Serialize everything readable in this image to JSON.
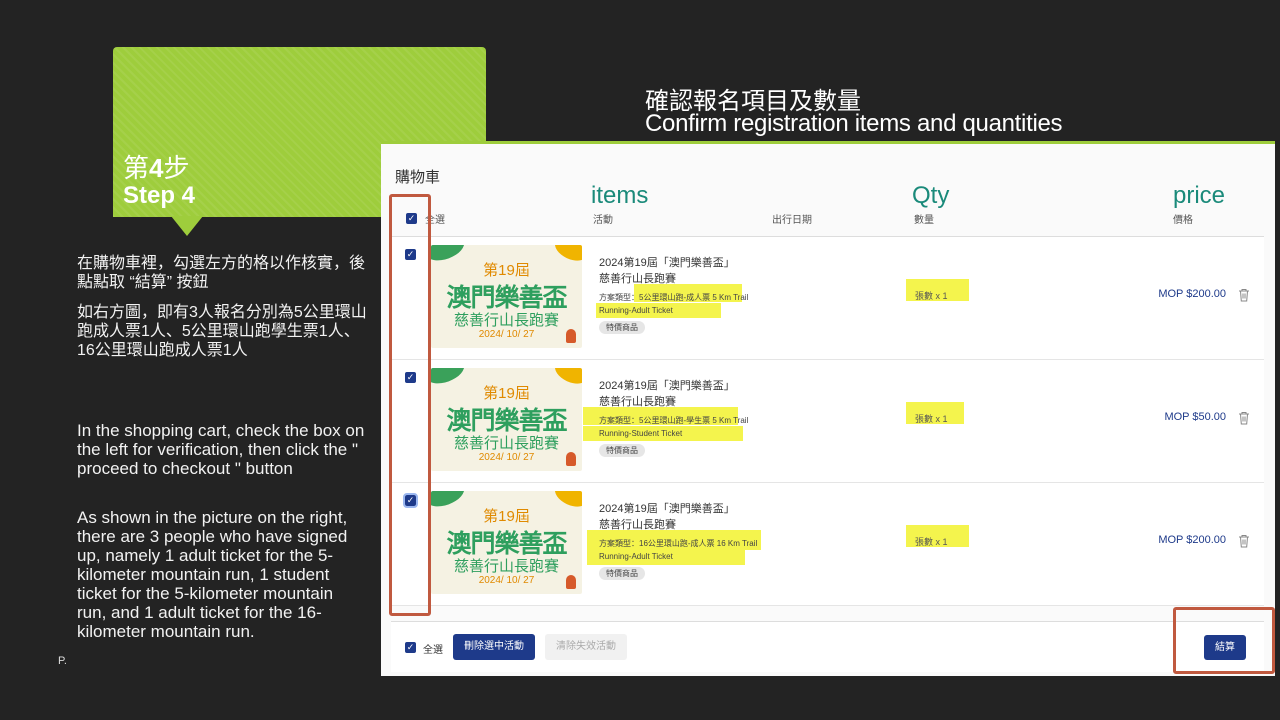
{
  "slide": {
    "step_zh_prefix": "第",
    "step_zh_num": "4",
    "step_zh_suffix": "步",
    "step_en": "Step 4",
    "title_zh": "確認報名項目及數量",
    "title_en": "Confirm registration items and quantities",
    "instruction_zh": "在購物車裡，勾選左方的格以作核實，後點點取 “結算” 按鈕",
    "example_zh": "如右方圖，即有3人報名分別為5公里環山跑成人票1人、5公里環山跑學生票1人、16公里環山跑成人票1人",
    "instruction_en": "In the shopping cart, check the box on the left for verification, then click the \" proceed to checkout \" button",
    "example_en": "As shown in the picture on the right, there are 3 people who have signed up, namely 1 adult ticket for the 5-kilometer mountain run, 1 student ticket for the 5-kilometer mountain run, and 1 adult ticket for the 16-kilometer mountain run.",
    "page_marker": "P."
  },
  "cart": {
    "title": "購物車",
    "annotations": {
      "items": "items",
      "qty": "Qty",
      "price": "price"
    },
    "columns": {
      "select_all": "全選",
      "activity": "活動",
      "date": "出行日期",
      "quantity": "數量",
      "price": "價格"
    },
    "banner": {
      "line1": "第19屆",
      "line2": "澳門樂善盃",
      "line3": "慈善行山長跑賽",
      "line4": "2024/ 10/ 27"
    },
    "items": [
      {
        "name": "2024第19屆「澳門樂善盃」慈善行山長跑賽",
        "plan_label": "方案類型：",
        "plan": "5公里環山跑-成人票 5 Km Trail Running-Adult Ticket",
        "tag": "特價商品",
        "qty": "張數 x 1",
        "price": "MOP $200.00"
      },
      {
        "name": "2024第19屆「澳門樂善盃」慈善行山長跑賽",
        "plan_label": "方案類型：",
        "plan": "5公里環山跑-學生票 5 Km Trail Running-Student Ticket",
        "tag": "特價商品",
        "qty": "張數 x 1",
        "price": "MOP $50.00"
      },
      {
        "name": "2024第19屆「澳門樂善盃」慈善行山長跑賽",
        "plan_label": "方案類型：",
        "plan": "16公里環山跑-成人票 16 Km Trail Running-Adult Ticket",
        "tag": "特價商品",
        "qty": "張數 x 1",
        "price": "MOP $200.00"
      }
    ],
    "footer": {
      "select_all": "全選",
      "remove_selected": "刪除選中活動",
      "clear_invalid": "清除失效活動",
      "checkout": "結算"
    }
  },
  "colors": {
    "banner_green": "#9ecd3c",
    "primary_blue": "#1e3a8a",
    "annotation_red": "#c0593f",
    "highlight_yellow": "#f2f22e",
    "annotation_teal": "#1a8a7a"
  },
  "icons": {
    "checkbox": "check-icon",
    "delete": "trash-icon"
  }
}
